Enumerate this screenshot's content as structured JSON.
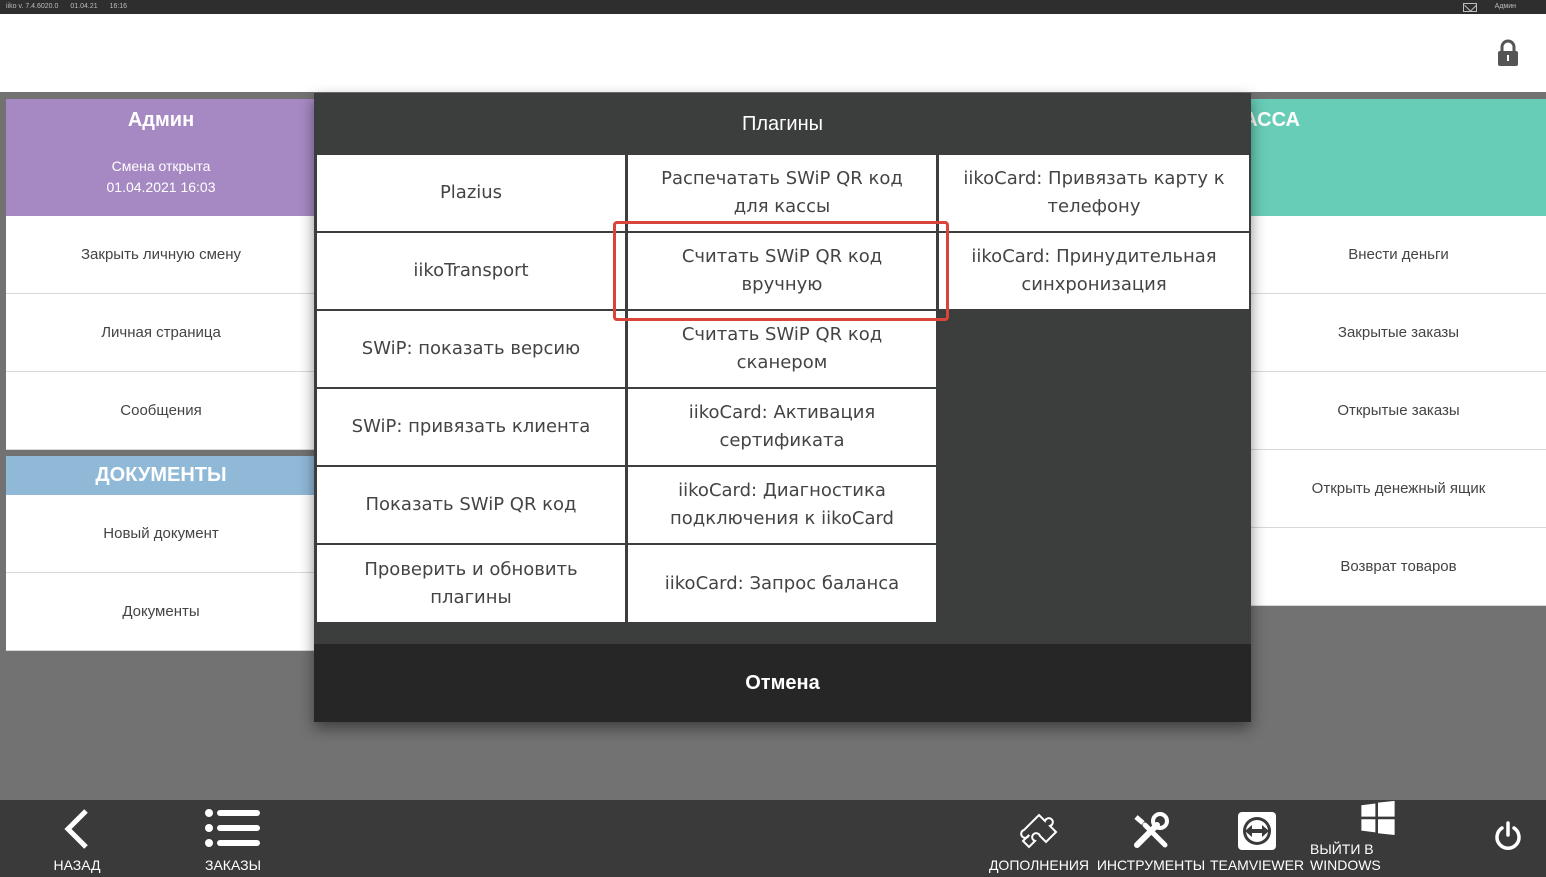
{
  "statusbar": {
    "app_version": "iiko v. 7.4.6020.0",
    "date": "01.04.21",
    "time": "16:16",
    "user": "Админ"
  },
  "left": {
    "admin_name": "Админ",
    "shift_status": "Смена открыта",
    "shift_datetime": "01.04.2021 16:03",
    "items": [
      "Закрыть личную смену",
      "Личная страница",
      "Сообщения"
    ],
    "documents_header": "ДОКУМЕНТЫ",
    "document_items": [
      "Новый документ",
      "Документы"
    ]
  },
  "right": {
    "kassa_header": "КАССА",
    "items": [
      "Внести деньги",
      "Закрытые заказы",
      "Открытые заказы",
      "Открыть денежный ящик",
      "Возврат товаров"
    ]
  },
  "dialog": {
    "title": "Плагины",
    "plugins": [
      [
        "Plazius",
        "Распечатать SWiP QR код для кассы",
        "iikoCard: Привязать карту к телефону"
      ],
      [
        "iikoTransport",
        "Считать SWiP QR код вручную",
        "iikoCard: Принудительная синхронизация"
      ],
      [
        "SWiP: показать версию",
        "Считать SWiP QR код сканером"
      ],
      [
        "SWiP: привязать клиента",
        "iikoCard: Активация сертификата"
      ],
      [
        "Показать SWiP QR код",
        "iikoCard: Диагностика подключения к iikoCard"
      ],
      [
        "Проверить и обновить плагины",
        "iikoCard: Запрос баланса"
      ]
    ],
    "cancel_label": "Отмена",
    "highlight_color": "#d9453a"
  },
  "bottombar": {
    "back": "НАЗАД",
    "orders": "ЗАКАЗЫ",
    "addons": "ДОПОЛНЕНИЯ",
    "tools": "ИНСТРУМЕНТЫ",
    "teamviewer": "TEAMVIEWER",
    "exit_windows": "ВЫЙТИ В WINDOWS"
  },
  "colors": {
    "admin": "#a689c3",
    "documents": "#90b9d8",
    "kassa": "#68cdb7",
    "dialog_bg": "#3c3e3d"
  }
}
